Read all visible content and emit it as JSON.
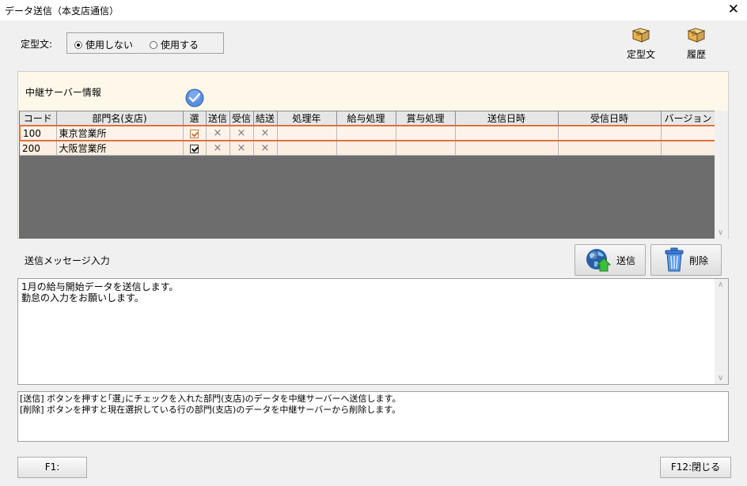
{
  "window": {
    "title": "データ送信（本支店通信）",
    "close_glyph": "✕"
  },
  "template": {
    "label": "定型文:",
    "options": [
      {
        "label": "使用しない",
        "selected": true
      },
      {
        "label": "使用する",
        "selected": false
      }
    ]
  },
  "toolbar": {
    "template_label": "定型文",
    "history_label": "履歴"
  },
  "relay": {
    "title": "中継サーバー情報",
    "columns": [
      "コード",
      "部門名(支店)",
      "選",
      "送信",
      "受信",
      "結送",
      "処理年",
      "給与処理",
      "賞与処理",
      "送信日時",
      "受信日時",
      "バージョン"
    ],
    "rows": [
      {
        "code": "100",
        "name": "東京営業所",
        "checked": true,
        "send": "×",
        "recv": "×",
        "kesso": "×",
        "year": "",
        "salary": "",
        "bonus": "",
        "sent_at": "",
        "recv_at": "",
        "version": ""
      },
      {
        "code": "200",
        "name": "大阪営業所",
        "checked": true,
        "send": "×",
        "recv": "×",
        "kesso": "×",
        "year": "",
        "salary": "",
        "bonus": "",
        "sent_at": "",
        "recv_at": "",
        "version": ""
      }
    ]
  },
  "message": {
    "title": "送信メッセージ入力",
    "send_label": "送信",
    "delete_label": "削除",
    "lines": [
      "1月の給与開始データを送信します。",
      "勤怠の入力をお願いします。"
    ]
  },
  "info": {
    "lines": [
      "[送信] ボタンを押すと｢選｣にチェックを入れた部門(支店)のデータを中継サーバーへ送信します。",
      "[削除] ボタンを押すと現在選択している行の部門(支店)のデータを中継サーバーから削除します。"
    ]
  },
  "footer": {
    "f1_label": "F1:",
    "f12_label": "F12:閉じる"
  },
  "colors": {
    "selected_row_border": "#e07040",
    "panel_bg": "#fdf8e9",
    "grid_bg": "#6d6d6d"
  }
}
